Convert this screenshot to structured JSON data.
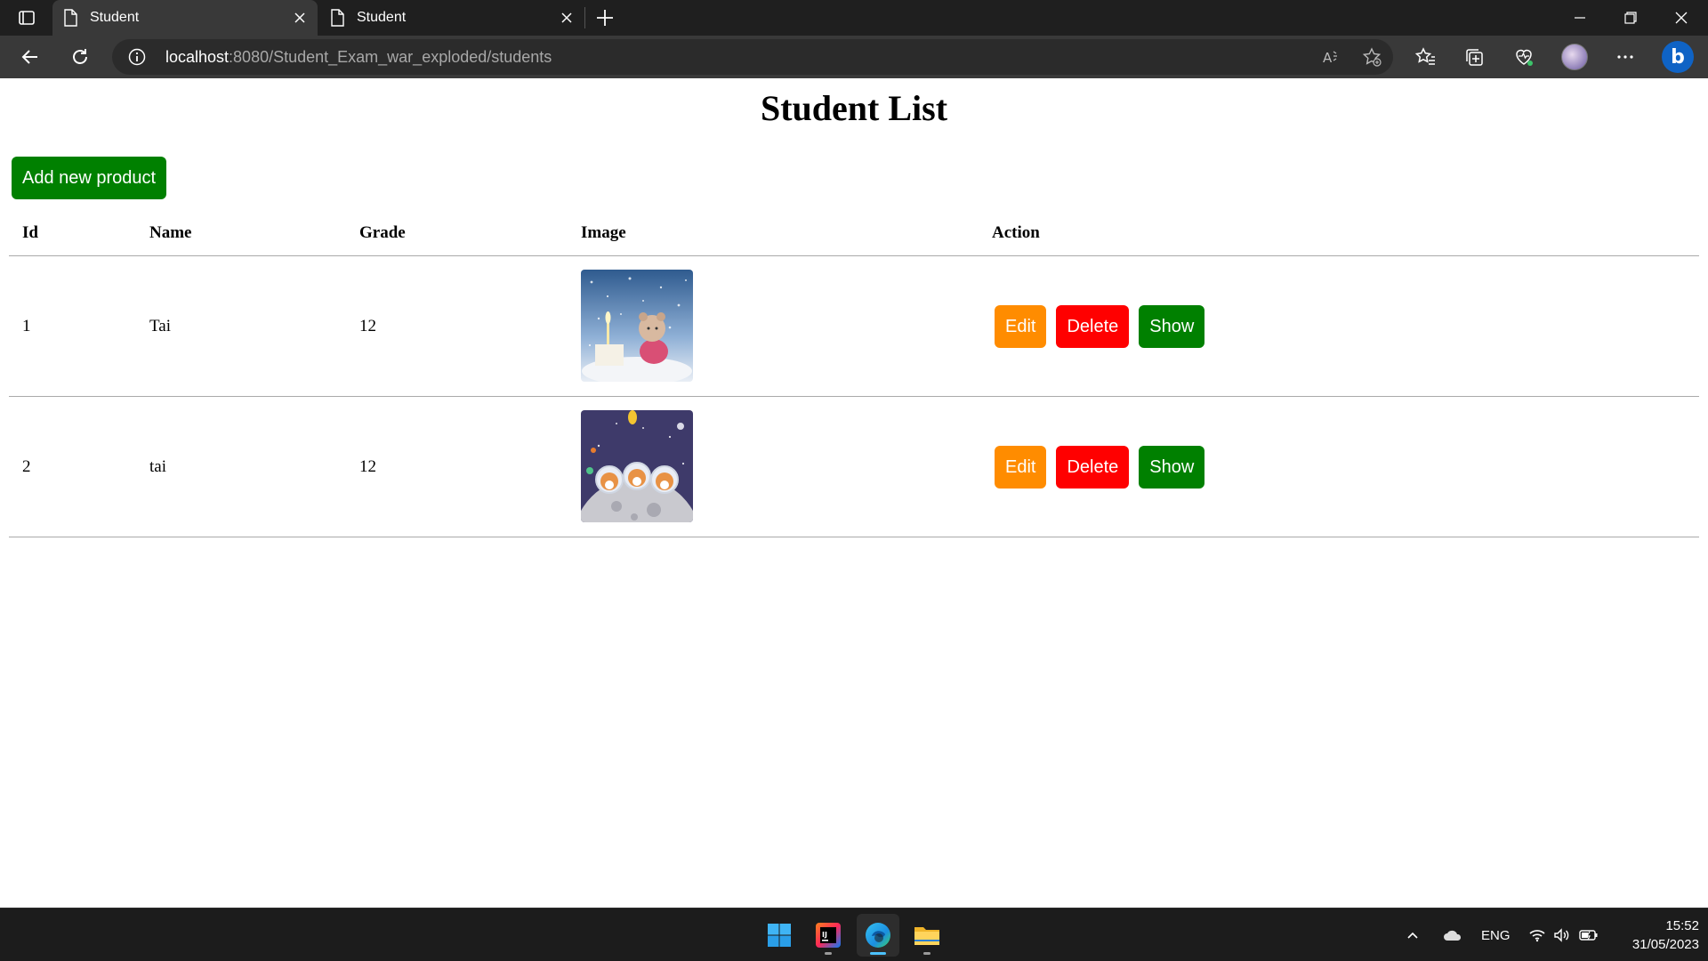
{
  "browser": {
    "tabs": [
      {
        "title": "Student"
      },
      {
        "title": "Student"
      }
    ],
    "url_host": "localhost",
    "url_rest": ":8080/Student_Exam_war_exploded/students"
  },
  "page": {
    "title": "Student List",
    "add_button": "Add new product",
    "columns": [
      "Id",
      "Name",
      "Grade",
      "Image",
      "Action"
    ],
    "rows": [
      {
        "id": "1",
        "name": "Tai",
        "grade": "12",
        "image": "snowy-candle-bear-thumbnail"
      },
      {
        "id": "2",
        "name": "tai",
        "grade": "12",
        "image": "space-shiba-dogs-thumbnail"
      }
    ],
    "actions": {
      "edit": "Edit",
      "delete": "Delete",
      "show": "Show"
    },
    "colors": {
      "edit": "#ff8c00",
      "delete": "#ff0000",
      "show": "#008000",
      "add": "#008000"
    }
  },
  "taskbar": {
    "language": "ENG",
    "time": "15:52",
    "date": "31/05/2023"
  }
}
